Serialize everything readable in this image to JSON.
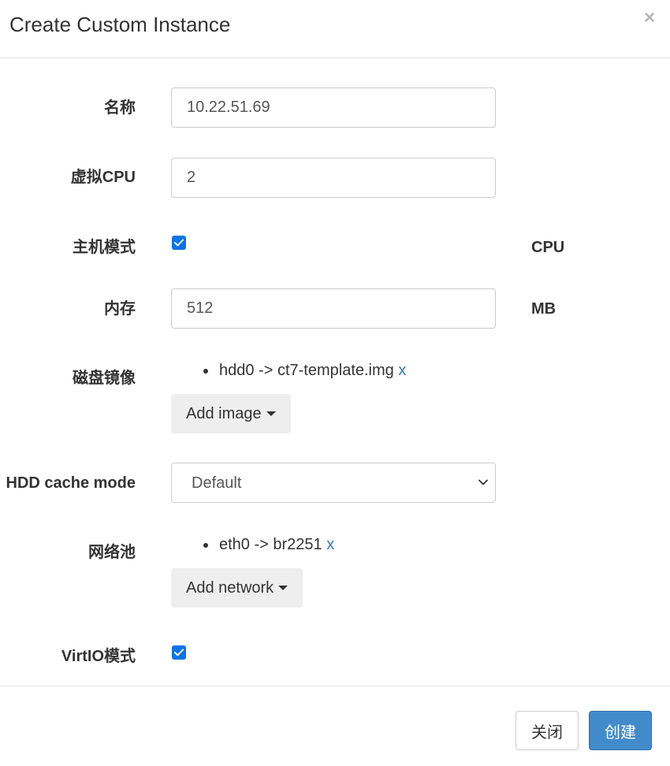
{
  "modal": {
    "title": "Create Custom Instance",
    "close_label": "×"
  },
  "form": {
    "name": {
      "label": "名称",
      "value": "10.22.51.69"
    },
    "vcpu": {
      "label": "虚拟CPU",
      "value": "2"
    },
    "host_mode": {
      "label": "主机模式",
      "checked": true,
      "unit": "CPU"
    },
    "memory": {
      "label": "内存",
      "value": "512",
      "unit": "MB"
    },
    "disk_image": {
      "label": "磁盘镜像",
      "items": [
        {
          "text": "hdd0 -> ct7-template.img",
          "remove": "x"
        }
      ],
      "add_label": "Add image"
    },
    "hdd_cache_mode": {
      "label": "HDD cache mode",
      "selected": "Default"
    },
    "network_pool": {
      "label": "网络池",
      "items": [
        {
          "text": "eth0 -> br2251",
          "remove": "x"
        }
      ],
      "add_label": "Add network"
    },
    "virtio_mode": {
      "label": "VirtIO模式",
      "checked": true
    }
  },
  "footer": {
    "close_label": "关闭",
    "create_label": "创建"
  },
  "colors": {
    "primary": "#428bca",
    "link": "#337ab7",
    "checkbox": "#0b74e5"
  }
}
